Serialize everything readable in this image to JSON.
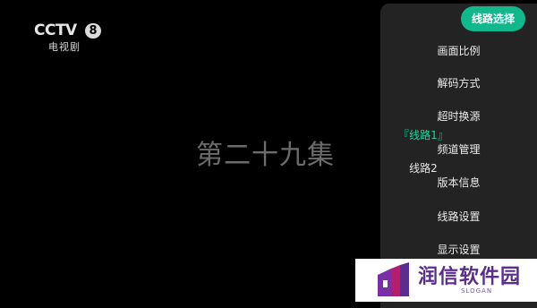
{
  "channel": {
    "logo_text": "CCTV",
    "logo_number": "8",
    "logo_subtitle": "电视剧"
  },
  "video": {
    "episode_title": "第二十九集"
  },
  "menu": {
    "items": [
      "线路选择",
      "画面比例",
      "解码方式",
      "超时换源",
      "频道管理",
      "版本信息",
      "线路设置",
      "显示设置"
    ],
    "selected_index": 0
  },
  "routes": [
    "『线路1』",
    "线路2"
  ],
  "watermark": {
    "text": "润信软件园",
    "slogan": "SLOGAN"
  },
  "colors": {
    "accent": "#12b78c",
    "active_route": "#1ed59f",
    "watermark": "#5a2d8e"
  }
}
